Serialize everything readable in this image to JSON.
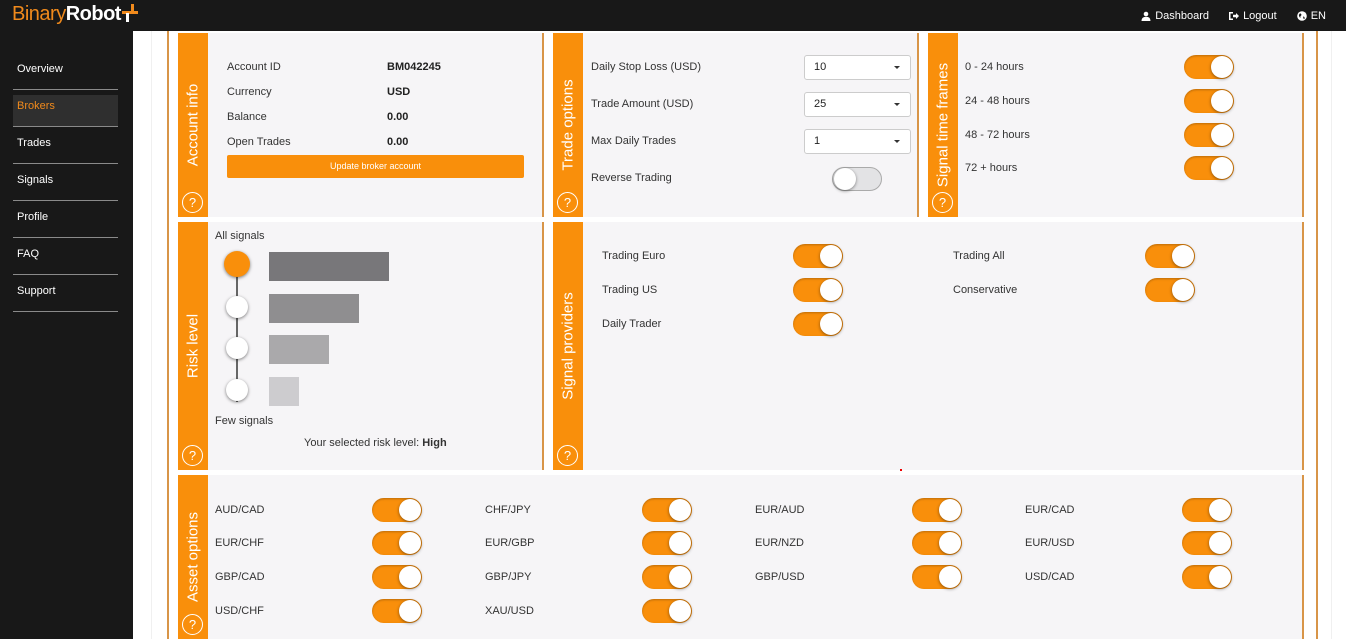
{
  "brand": {
    "name_part1": "Binary",
    "name_part2": "Robot"
  },
  "topnav": [
    {
      "label": "Dashboard",
      "icon": "user-icon"
    },
    {
      "label": "Logout",
      "icon": "sign-out-icon"
    },
    {
      "label": "EN",
      "icon": "globe-icon"
    }
  ],
  "sidebar": {
    "items": [
      {
        "label": "Overview",
        "active": false
      },
      {
        "label": "Brokers",
        "active": true
      },
      {
        "label": "Trades",
        "active": false
      },
      {
        "label": "Signals",
        "active": false
      },
      {
        "label": "Profile",
        "active": false
      },
      {
        "label": "FAQ",
        "active": false
      },
      {
        "label": "Support",
        "active": false
      }
    ]
  },
  "colors": {
    "accent": "#f98f0b",
    "panel_bg": "#f6f5f7",
    "frame": "#d89548",
    "nav_bg": "#181818"
  },
  "account_info": {
    "title": "Account info",
    "help": "?",
    "rows": [
      {
        "label": "Account ID",
        "value": "BM042245"
      },
      {
        "label": "Currency",
        "value": "USD"
      },
      {
        "label": "Balance",
        "value": "0.00"
      },
      {
        "label": "Open Trades",
        "value": "0.00"
      }
    ],
    "update_button": "Update broker account"
  },
  "trade_options": {
    "title": "Trade options",
    "help": "?",
    "daily_stop_loss": {
      "label": "Daily Stop Loss (USD)",
      "value": "10"
    },
    "trade_amount": {
      "label": "Trade Amount (USD)",
      "value": "25"
    },
    "max_daily_trades": {
      "label": "Max Daily Trades",
      "value": "1"
    },
    "reverse_trading": {
      "label": "Reverse Trading",
      "enabled": false
    }
  },
  "signal_time_frames": {
    "title": "Signal time frames",
    "help": "?",
    "items": [
      {
        "label": "0 - 24 hours",
        "enabled": true
      },
      {
        "label": "24 - 48 hours",
        "enabled": true
      },
      {
        "label": "48 - 72 hours",
        "enabled": true
      },
      {
        "label": "72 + hours",
        "enabled": true
      }
    ]
  },
  "risk_level": {
    "title": "Risk level",
    "help": "?",
    "top_label": "All signals",
    "bottom_label": "Few signals",
    "levels": 4,
    "selected_index": 0,
    "selected_prefix": "Your selected risk level: ",
    "selected_value": "High"
  },
  "signal_providers": {
    "title": "Signal providers",
    "help": "?",
    "items": [
      {
        "label": "Trading Euro",
        "enabled": true
      },
      {
        "label": "Trading US",
        "enabled": true
      },
      {
        "label": "Daily Trader",
        "enabled": true
      },
      {
        "label": "Trading All",
        "enabled": true
      },
      {
        "label": "Conservative",
        "enabled": true
      }
    ]
  },
  "asset_options": {
    "title": "Asset options",
    "help": "?",
    "items": [
      {
        "label": "AUD/CAD",
        "enabled": true
      },
      {
        "label": "EUR/CHF",
        "enabled": true
      },
      {
        "label": "GBP/CAD",
        "enabled": true
      },
      {
        "label": "USD/CHF",
        "enabled": true
      },
      {
        "label": "CHF/JPY",
        "enabled": true
      },
      {
        "label": "EUR/GBP",
        "enabled": true
      },
      {
        "label": "GBP/JPY",
        "enabled": true
      },
      {
        "label": "XAU/USD",
        "enabled": true
      },
      {
        "label": "EUR/AUD",
        "enabled": true
      },
      {
        "label": "EUR/NZD",
        "enabled": true
      },
      {
        "label": "GBP/USD",
        "enabled": true
      },
      {
        "label": "EUR/CAD",
        "enabled": true
      },
      {
        "label": "EUR/USD",
        "enabled": true
      },
      {
        "label": "USD/CAD",
        "enabled": true
      }
    ]
  }
}
